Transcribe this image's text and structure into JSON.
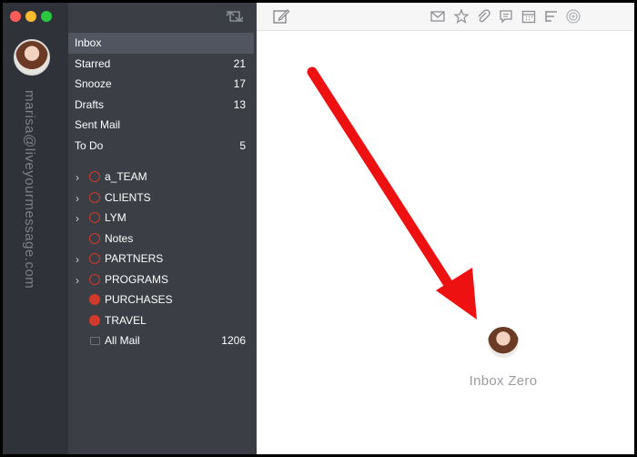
{
  "account": {
    "email": "marisa@liveyourmessage.com"
  },
  "folders": [
    {
      "label": "Inbox",
      "count": "",
      "selected": true
    },
    {
      "label": "Starred",
      "count": "21"
    },
    {
      "label": "Snooze",
      "count": "17"
    },
    {
      "label": "Drafts",
      "count": "13"
    },
    {
      "label": "Sent Mail",
      "count": ""
    },
    {
      "label": "To Do",
      "count": "5"
    }
  ],
  "labels": [
    {
      "label": "a_TEAM",
      "expandable": true,
      "marker": "ring"
    },
    {
      "label": "CLIENTS",
      "expandable": true,
      "marker": "ring"
    },
    {
      "label": "LYM",
      "expandable": true,
      "marker": "ring"
    },
    {
      "label": "Notes",
      "expandable": false,
      "marker": "ring"
    },
    {
      "label": "PARTNERS",
      "expandable": true,
      "marker": "ring"
    },
    {
      "label": "PROGRAMS",
      "expandable": true,
      "marker": "ring"
    },
    {
      "label": "PURCHASES",
      "expandable": false,
      "marker": "dot"
    },
    {
      "label": "TRAVEL",
      "expandable": false,
      "marker": "dot"
    },
    {
      "label": "All Mail",
      "expandable": false,
      "marker": "box",
      "count": "1206"
    }
  ],
  "toolbar": {
    "icons": [
      "compose-icon",
      "mail-icon",
      "star-icon",
      "paperclip-icon",
      "speech-bubble-icon",
      "calendar-icon",
      "list-icon",
      "target-icon"
    ]
  },
  "main": {
    "empty_state_text": "Inbox Zero"
  },
  "colors": {
    "label_red": "#d1392a",
    "arrow_red": "#ee1111",
    "sidebar_bg": "#3b3e45"
  }
}
